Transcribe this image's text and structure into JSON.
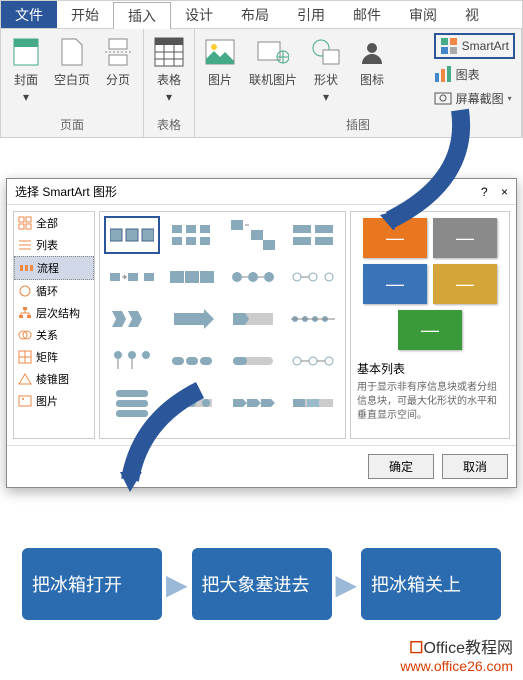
{
  "ribbon": {
    "tabs": {
      "file": "文件",
      "home": "开始",
      "insert": "插入",
      "design": "设计",
      "layout": "布局",
      "references": "引用",
      "mail": "邮件",
      "review": "审阅",
      "view": "视"
    },
    "groups": {
      "pages": "页面",
      "tables": "表格",
      "illustrations": "插图"
    },
    "buttons": {
      "cover": "封面",
      "blank": "空白页",
      "break": "分页",
      "table": "表格",
      "picture": "图片",
      "online_pic": "联机图片",
      "shapes": "形状",
      "icons": "图标",
      "smartart": "SmartArt",
      "chart": "图表",
      "screenshot": "屏幕截图"
    }
  },
  "dialog": {
    "title": "选择 SmartArt 图形",
    "help": "?",
    "close": "×",
    "categories": {
      "all": "全部",
      "list": "列表",
      "process": "流程",
      "cycle": "循环",
      "hierarchy": "层次结构",
      "relationship": "关系",
      "matrix": "矩阵",
      "pyramid": "棱锥图",
      "picture": "图片"
    },
    "preview_name": "基本列表",
    "preview_desc": "用于显示非有序信息块或者分组信息块，可最大化形状的水平和垂直显示空间。",
    "ok": "确定",
    "cancel": "取消"
  },
  "chart_data": {
    "type": "process",
    "steps": [
      "把冰箱打开",
      "把大象塞进去",
      "把冰箱关上"
    ]
  },
  "watermark": {
    "brand": "Office教程网",
    "url": "www.office26.com"
  }
}
